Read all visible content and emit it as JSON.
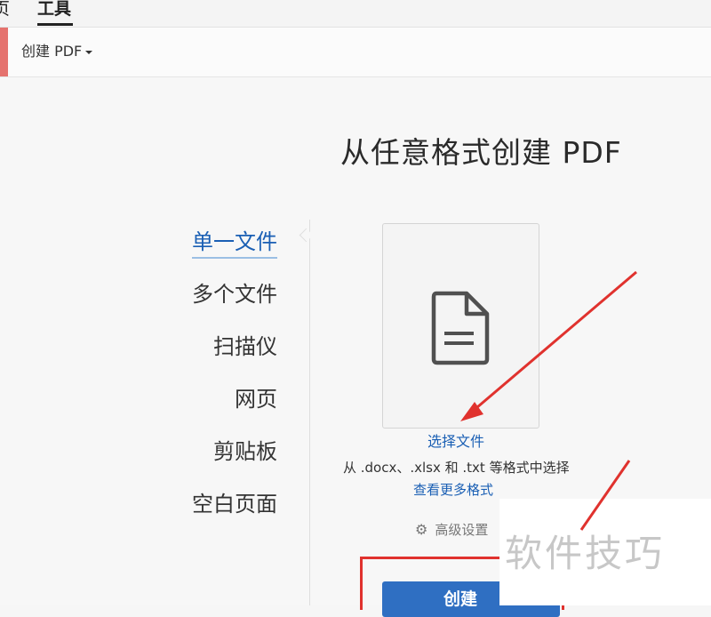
{
  "topnav": {
    "prev_tab_fragment": "页",
    "tools_tab": "工具"
  },
  "toolbar": {
    "create_pdf_menu": "创建 PDF"
  },
  "heading": "从任意格式创建 PDF",
  "sidebar": {
    "items": [
      {
        "label": "单一文件",
        "active": true
      },
      {
        "label": "多个文件",
        "active": false
      },
      {
        "label": "扫描仪",
        "active": false
      },
      {
        "label": "网页",
        "active": false
      },
      {
        "label": "剪贴板",
        "active": false
      },
      {
        "label": "空白页面",
        "active": false
      }
    ]
  },
  "file_picker": {
    "icon": "document-icon",
    "choose_label": "选择文件",
    "formats_note": "从 .docx、.xlsx 和 .txt 等格式中选择",
    "more_formats_link": "查看更多格式"
  },
  "advanced_settings": {
    "icon": "gear-icon",
    "label": "高级设置"
  },
  "create_button": "创建",
  "watermark": "软件技巧",
  "colors": {
    "accent_blue": "#2f6fc2",
    "link_blue": "#1a5fb4",
    "annotation_red": "#e0322e",
    "toolbar_accent": "#e5726e"
  }
}
